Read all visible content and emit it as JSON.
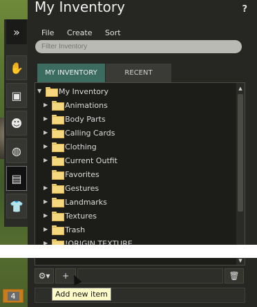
{
  "window": {
    "title": "My Inventory",
    "help_label": "?"
  },
  "menu": [
    "File",
    "Create",
    "Sort"
  ],
  "filter": {
    "placeholder": "Filter Inventory"
  },
  "tabs": {
    "active": "MY INVENTORY",
    "inactive": "RECENT"
  },
  "tree": {
    "root": "My Inventory",
    "items": [
      {
        "label": "Animations",
        "expandable": true
      },
      {
        "label": "Body Parts",
        "expandable": true
      },
      {
        "label": "Calling Cards",
        "expandable": true
      },
      {
        "label": "Clothing",
        "expandable": true
      },
      {
        "label": "Current Outfit",
        "expandable": true
      },
      {
        "label": "Favorites",
        "expandable": false
      },
      {
        "label": "Gestures",
        "expandable": true
      },
      {
        "label": "Landmarks",
        "expandable": true
      },
      {
        "label": "Textures",
        "expandable": true
      },
      {
        "label": "Trash",
        "expandable": true
      },
      {
        "label": "!ORIGIN TEXTURE",
        "expandable": true
      }
    ]
  },
  "bottom": {
    "add_label": "+",
    "tooltip": "Add new item"
  },
  "notification": {
    "count": "4"
  },
  "colors": {
    "active_tab": "#3c6b5f",
    "folder": "#f5d77f",
    "tooltip_bg": "#fffbc8",
    "badge": "#c77c1e"
  },
  "toolbar_icons": [
    "expand-arrows-icon",
    "hand-gesture-icon",
    "profile-card-icon",
    "people-icon",
    "world-map-icon",
    "inventory-suitcase-icon",
    "appearance-shirt-icon"
  ]
}
